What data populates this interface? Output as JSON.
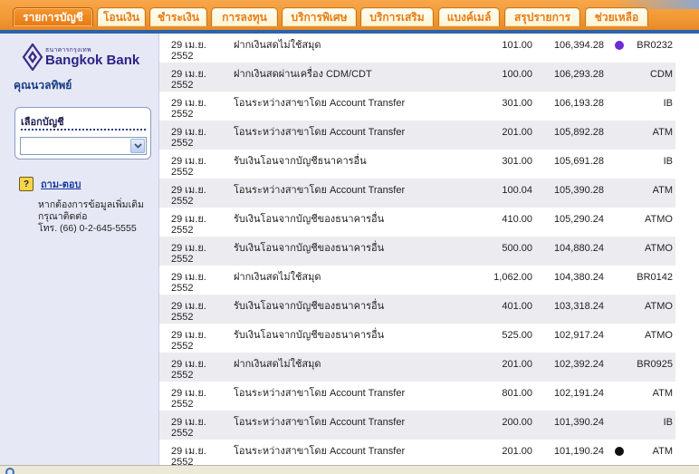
{
  "tabs": [
    {
      "label": "รายการบัญชี",
      "active": true
    },
    {
      "label": "โอนเงิน",
      "active": false
    },
    {
      "label": "ชำระเงิน",
      "active": false
    },
    {
      "label": "การลงทุน",
      "active": false
    },
    {
      "label": "บริการพิเศษ",
      "active": false
    },
    {
      "label": "บริการเสริม",
      "active": false
    },
    {
      "label": "แบงค์เมล์",
      "active": false
    },
    {
      "label": "สรุปรายการ",
      "active": false
    },
    {
      "label": "ช่วยเหลือ",
      "active": false
    }
  ],
  "sidebar": {
    "logo_thai": "ธนาคารกรุงเทพ",
    "logo_en": "Bangkok Bank",
    "user_name": "คุณนวลทิพย์",
    "account_box_title": "เลือกบัญชี",
    "account_select_value": "",
    "qa_icon": "?",
    "qa_link": "ถาม-ตอบ",
    "help_text_1": "หากต้องการข้อมูลเพิ่มเติม",
    "help_text_2": "กรุณาติดต่อ",
    "help_text_3": "โทร. (66) 0-2-645-5555"
  },
  "transactions": [
    {
      "date": "29 เม.ย. 2552",
      "desc": "ฝากเงินสดไม่ใช้สมุด",
      "amount": "101.00",
      "balance": "106,394.28",
      "mark_color": "#6b2bd6",
      "channel": "BR0232"
    },
    {
      "date": "29 เม.ย. 2552",
      "desc": "ฝากเงินสดผ่านเครื่อง CDM/CDT",
      "amount": "100.00",
      "balance": "106,293.28",
      "mark_color": "",
      "channel": "CDM"
    },
    {
      "date": "29 เม.ย. 2552",
      "desc": "โอนระหว่างสาขาโดย Account Transfer",
      "amount": "301.00",
      "balance": "106,193.28",
      "mark_color": "",
      "channel": "IB"
    },
    {
      "date": "29 เม.ย. 2552",
      "desc": "โอนระหว่างสาขาโดย Account Transfer",
      "amount": "201.00",
      "balance": "105,892.28",
      "mark_color": "",
      "channel": "ATM"
    },
    {
      "date": "29 เม.ย. 2552",
      "desc": "รับเงินโอนจากบัญชีธนาคารอื่น",
      "amount": "301.00",
      "balance": "105,691.28",
      "mark_color": "",
      "channel": "IB"
    },
    {
      "date": "29 เม.ย. 2552",
      "desc": "โอนระหว่างสาขาโดย Account Transfer",
      "amount": "100.04",
      "balance": "105,390.28",
      "mark_color": "",
      "channel": "ATM"
    },
    {
      "date": "29 เม.ย. 2552",
      "desc": "รับเงินโอนจากบัญชีของธนาคารอื่น",
      "amount": "410.00",
      "balance": "105,290.24",
      "mark_color": "",
      "channel": "ATMO"
    },
    {
      "date": "29 เม.ย. 2552",
      "desc": "รับเงินโอนจากบัญชีของธนาคารอื่น",
      "amount": "500.00",
      "balance": "104,880.24",
      "mark_color": "",
      "channel": "ATMO"
    },
    {
      "date": "29 เม.ย. 2552",
      "desc": "ฝากเงินสดไม่ใช้สมุด",
      "amount": "1,062.00",
      "balance": "104,380.24",
      "mark_color": "",
      "channel": "BR0142"
    },
    {
      "date": "29 เม.ย. 2552",
      "desc": "รับเงินโอนจากบัญชีของธนาคารอื่น",
      "amount": "401.00",
      "balance": "103,318.24",
      "mark_color": "",
      "channel": "ATMO"
    },
    {
      "date": "29 เม.ย. 2552",
      "desc": "รับเงินโอนจากบัญชีของธนาคารอื่น",
      "amount": "525.00",
      "balance": "102,917.24",
      "mark_color": "",
      "channel": "ATMO"
    },
    {
      "date": "29 เม.ย. 2552",
      "desc": "ฝากเงินสดไม่ใช้สมุด",
      "amount": "201.00",
      "balance": "102,392.24",
      "mark_color": "",
      "channel": "BR0925"
    },
    {
      "date": "29 เม.ย. 2552",
      "desc": "โอนระหว่างสาขาโดย Account Transfer",
      "amount": "801.00",
      "balance": "102,191.24",
      "mark_color": "",
      "channel": "ATM"
    },
    {
      "date": "29 เม.ย. 2552",
      "desc": "โอนระหว่างสาขาโดย Account Transfer",
      "amount": "200.00",
      "balance": "101,390.24",
      "mark_color": "",
      "channel": "IB"
    },
    {
      "date": "29 เม.ย. 2552",
      "desc": "โอนระหว่างสาขาโดย Account Transfer",
      "amount": "201.00",
      "balance": "101,190.24",
      "mark_color": "#111111",
      "channel": "ATM"
    }
  ],
  "colors": {
    "tab_bar": "#f39a35",
    "tab_active": "#e57a14",
    "sidebar_bg": "#e6e8f6",
    "row_shade": "#ececf0",
    "brand_blue": "#2c2485"
  }
}
